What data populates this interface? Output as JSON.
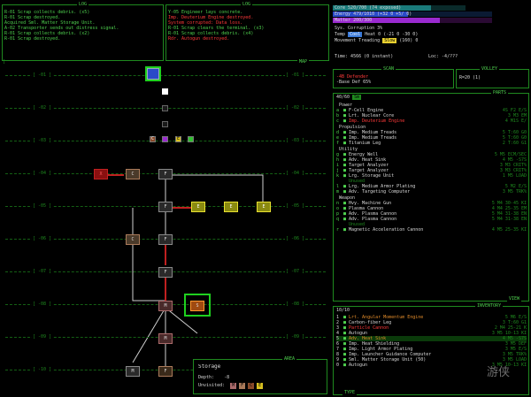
{
  "log1": {
    "title": "LOG",
    "lines": [
      {
        "t": "R-01 Scrap collects debris. (x5)",
        "c": "g"
      },
      {
        "t": "R-01 Scrap destroyed.",
        "c": "g"
      },
      {
        "t": "Acquired Sml. Matter Storage Unit.",
        "c": "g"
      },
      {
        "t": "A-02 Transporter sends out distress signal.",
        "c": "g"
      },
      {
        "t": "R-01 Scrap collects debris. (x2)",
        "c": "g"
      },
      {
        "t": "R-01 Scrap destroyed.",
        "c": "g"
      }
    ]
  },
  "log2": {
    "title": "LOG",
    "lines": [
      {
        "t": "Y-05 Engineer lays concrete.",
        "c": "g"
      },
      {
        "t": "Imp. Deuterium Engine destroyed.",
        "c": "r"
      },
      {
        "t": "System corrupted: Data loss.",
        "c": "r"
      },
      {
        "t": "R-01 Scrap clears the terminal. (x3)",
        "c": "g"
      },
      {
        "t": "R-01 Scrap collects debris. (x4)",
        "c": "g"
      },
      {
        "t": "Rdr. Autogun destroyed.",
        "c": "r"
      }
    ]
  },
  "status": {
    "core": "Core  520/700 (74 exposed)",
    "energy": "Energy 479/1010 (+32 0 +5/ 0)",
    "matter": "Matter 200/300",
    "sys": "Sys. Corruption 3%",
    "temp": "Temp",
    "temp_val": "Cool",
    "temp_detail": "Heat 0 (-21 0 -30 0)",
    "move": "Movement  Treading",
    "move_val": "Slow",
    "move_detail": "(160) 0",
    "time": "Time: 4566 (0 instant)",
    "loc": "Loc: -4/???",
    "core_fill": 0.74,
    "energy_fill": 0.47,
    "matter_fill": 0.67
  },
  "scan": {
    "title": "SCAN",
    "lines": [
      "-4B Defender",
      "-Base Def 65%"
    ]
  },
  "volley": {
    "title": "VOLLEY",
    "lines": [
      "R=20 (1)"
    ]
  },
  "parts": {
    "title": "PARTS",
    "header_left": "40/60",
    "header_tag": "Sm",
    "sections": [
      {
        "name": "Power",
        "items": [
          {
            "k": "a",
            "n": "F-Cell Engine",
            "v": "4S F2 E/S",
            "c": "w"
          },
          {
            "k": "b",
            "n": "Lrt. Nuclear Core",
            "v": "3 M3 EM",
            "c": "w"
          },
          {
            "k": "c",
            "n": "Imp. Deuterium Engine",
            "v": "4 M1S E/",
            "c": "r"
          }
        ]
      },
      {
        "name": "Propulsion",
        "items": [
          {
            "k": "d",
            "n": "Imp. Medium Treads",
            "v": "5 T:60 G0",
            "c": "w"
          },
          {
            "k": "e",
            "n": "Imp. Medium Treads",
            "v": "5 T:60 G0",
            "c": "w"
          },
          {
            "k": "f",
            "n": "Titanium Leg",
            "v": "2 T:60 G1",
            "c": "w"
          }
        ]
      },
      {
        "name": "Utility",
        "items": [
          {
            "k": "g",
            "n": "Energy Well",
            "v": "5 M5 ECM/SEC",
            "c": "w"
          },
          {
            "k": "h",
            "n": "Adv. Heat Sink",
            "v": "4 M5 -S7S",
            "c": "w"
          },
          {
            "k": "i",
            "n": "Target Analyzer",
            "v": "3 M3 CRIT%",
            "c": "w"
          },
          {
            "k": "j",
            "n": "Target Analyzer",
            "v": "3 M3 CRIT%",
            "c": "w"
          },
          {
            "k": "k",
            "n": "Lrg. Storage Unit",
            "v": "1 M5 LOAD",
            "c": "w"
          },
          {
            "k": "",
            "n": "Unused",
            "v": "",
            "c": "dg"
          },
          {
            "k": "l",
            "n": "Lrg. Medium Armor Plating",
            "v": "5 M2 E/S",
            "c": "w"
          },
          {
            "k": "m",
            "n": "Adv. Targeting Computer",
            "v": "3 M5 TRK%",
            "c": "w"
          }
        ]
      },
      {
        "name": "Weapon",
        "items": [
          {
            "k": "n",
            "n": "Hvy. Machine Gun",
            "v": "5 M4 30-45 KI",
            "c": "w"
          },
          {
            "k": "o",
            "n": "Plasma Cannon",
            "v": "4 M4 25-35 EM",
            "c": "w"
          },
          {
            "k": "p",
            "n": "Adv. Plasma Cannon",
            "v": "5 M4 31-38 EN",
            "c": "w"
          },
          {
            "k": "q",
            "n": "Adv. Plasma Cannon",
            "v": "5 M4 31-38 EN",
            "c": "w"
          },
          {
            "k": "",
            "n": "Unused",
            "v": "",
            "c": "dg"
          },
          {
            "k": "r",
            "n": "Magnetic Acceleration Cannon",
            "v": "4 M5 25-35 KI",
            "c": "w"
          }
        ]
      }
    ],
    "footer": "VIEW"
  },
  "inventory": {
    "title": "INVENTORY",
    "header_left": "10/10",
    "items": [
      {
        "k": "1",
        "n": "Lrt. Angular Momentum Engine",
        "v": "5 M6 E/S",
        "c": "o"
      },
      {
        "k": "2",
        "n": "Carbon-fiber Leg",
        "v": "3 T:60 G1",
        "c": "w"
      },
      {
        "k": "3",
        "n": "Particle Cannon",
        "v": "2 M4 25-21 K",
        "c": "r"
      },
      {
        "k": "4",
        "n": "Autogun",
        "v": "3 M5 10-13 KI",
        "c": "w"
      },
      {
        "k": "5",
        "n": "Adv. Heat Sink",
        "v": "4 M5 -S7S",
        "c": "o"
      },
      {
        "k": "6",
        "n": "Imp. Heat Shielding",
        "v": "3 M5 DEF",
        "c": "w"
      },
      {
        "k": "7",
        "n": "Imp. Light Armor Plating",
        "v": "3 M5 E/S",
        "c": "w"
      },
      {
        "k": "8",
        "n": "Imp. Launcher Guidance Computer",
        "v": "3 M5 TRK%",
        "c": "w"
      },
      {
        "k": "9",
        "n": "Sml. Matter Storage Unit (50)",
        "v": "3 M5 LOAD",
        "c": "w"
      },
      {
        "k": "0",
        "n": "Autogun",
        "v": "3 M5 10-13 KI",
        "c": "w"
      }
    ],
    "footer": "TYPE"
  },
  "map": {
    "title": "MAP",
    "levels": [
      "-01",
      "-02",
      "-03",
      "-04",
      "-05",
      "-06",
      "-07",
      "-08",
      "-09",
      "-10"
    ],
    "area": {
      "title": "AREA",
      "name": "Storage",
      "depth_label": "Depth:",
      "depth_val": "-8",
      "unvisited_label": "Unvisited:",
      "unvisited": [
        "M",
        "F",
        "C",
        "E"
      ]
    }
  }
}
